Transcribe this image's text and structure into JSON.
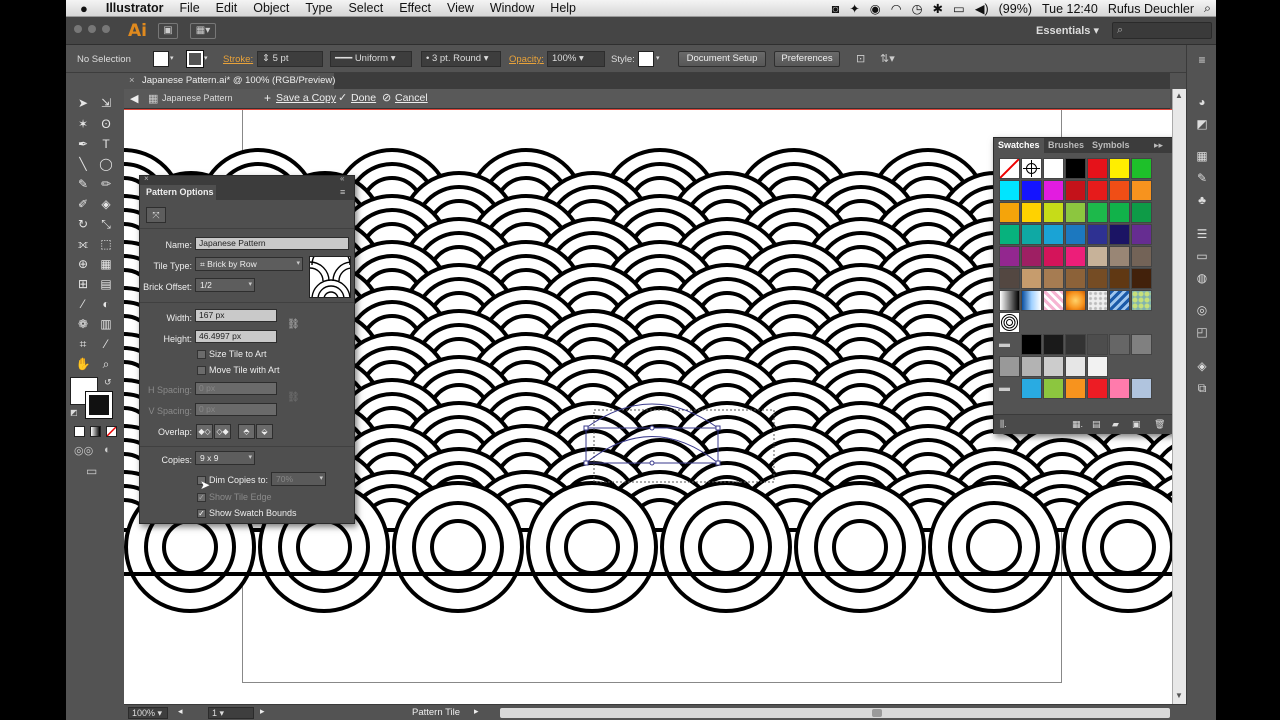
{
  "menubar": {
    "app_name": "Illustrator",
    "items": [
      "File",
      "Edit",
      "Object",
      "Type",
      "Select",
      "Effect",
      "View",
      "Window",
      "Help"
    ],
    "battery": "(99%)",
    "clock": "Tue 12:40",
    "user": "Rufus Deuchler"
  },
  "appbar": {
    "logo": "Ai",
    "workspace": "Essentials"
  },
  "control": {
    "selection": "No Selection",
    "stroke_label": "Stroke:",
    "stroke_value": "5 pt",
    "profile": "Uniform",
    "brush": "3 pt. Round",
    "opacity_label": "Opacity:",
    "opacity_value": "100%",
    "style_label": "Style:",
    "doc_setup": "Document Setup",
    "preferences": "Preferences"
  },
  "document": {
    "tab_title": "Japanese Pattern.ai* @ 100% (RGB/Preview)",
    "breadcrumb": "Japanese Pattern",
    "save_copy": "Save a Copy",
    "done": "Done",
    "cancel": "Cancel"
  },
  "pattern_options": {
    "title": "Pattern Options",
    "name_label": "Name:",
    "name_value": "Japanese Pattern",
    "tile_type_label": "Tile Type:",
    "tile_type_value": "Brick by Row",
    "brick_offset_label": "Brick Offset:",
    "brick_offset_value": "1/2",
    "width_label": "Width:",
    "width_value": "167 px",
    "height_label": "Height:",
    "height_value": "46.4997 px",
    "size_tile_to_art": "Size Tile to Art",
    "move_tile_with_art": "Move Tile with Art",
    "h_spacing_label": "H Spacing:",
    "h_spacing_value": "0 px",
    "v_spacing_label": "V Spacing:",
    "v_spacing_value": "0 px",
    "overlap_label": "Overlap:",
    "copies_label": "Copies:",
    "copies_value": "9 x 9",
    "dim_copies": "Dim Copies to:",
    "dim_value": "70%",
    "show_tile_edge": "Show Tile Edge",
    "show_swatch_bounds": "Show Swatch Bounds"
  },
  "swatches": {
    "tabs": [
      "Swatches",
      "Brushes",
      "Symbols"
    ],
    "rows": [
      [
        "none",
        "reg",
        "#ffffff",
        "#000000",
        "#e5121a",
        "#ffee00",
        "#1ec02a"
      ],
      [
        "#00e5ff",
        "#1414ff",
        "#e21ce0",
        "#c4121a",
        "#e61b1b",
        "#f04e16",
        "#f7931e"
      ],
      [
        "#f5a40a",
        "#ffd200",
        "#c6dc18",
        "#8cc63f",
        "#1db94b",
        "#11b24a",
        "#0e9b47"
      ],
      [
        "#07b27d",
        "#0fa9a4",
        "#1aa3d5",
        "#1c78bf",
        "#2e3192",
        "#1b1464",
        "#662d91"
      ],
      [
        "#93278f",
        "#9e1f63",
        "#d4145a",
        "#ed1e79",
        "#c7b299",
        "#998675",
        "#736357"
      ],
      [
        "#534741",
        "#c69c6d",
        "#a67c52",
        "#8c6239",
        "#754c24",
        "#603813",
        "#42210b"
      ],
      [
        "grad-bw",
        "grad-blue",
        "pat-pink",
        "grad-orange",
        "pat-dots",
        "pat-blue",
        "pat-green"
      ],
      [
        "pat-circle"
      ],
      [
        "folder",
        "#000000",
        "#1a1a1a",
        "#333333",
        "#4d4d4d",
        "#666666",
        "#808080"
      ],
      [
        "#999999",
        "#b3b3b3",
        "#cccccc",
        "#e6e6e6",
        "#f2f2f2"
      ],
      [
        "folder",
        "#29abe2",
        "#8cc63f",
        "#f7931e",
        "#ed1c24",
        "#ff7bac",
        "#b0c4de"
      ]
    ]
  },
  "status": {
    "zoom": "100%",
    "artboard": "1",
    "tool": "Pattern Tile"
  }
}
